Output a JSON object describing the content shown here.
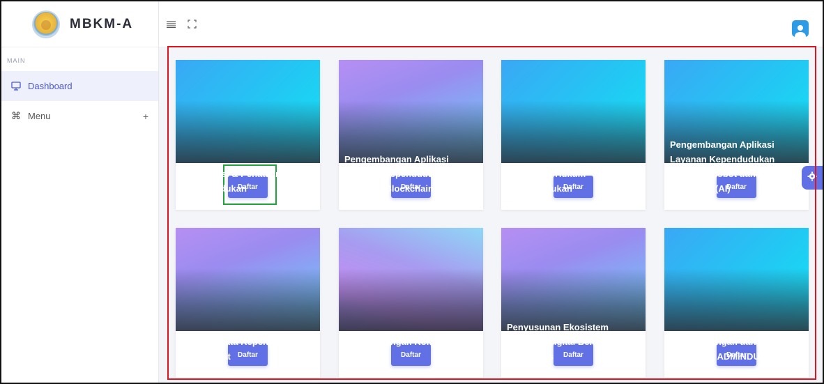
{
  "brand": {
    "name": "MBKM-A",
    "logo_icon": "university-logo-icon"
  },
  "sidebar": {
    "section_label": "MAIN",
    "items": [
      {
        "label": "Dashboard",
        "icon": "monitor-icon",
        "active": true
      },
      {
        "label": "Menu",
        "icon": "command-icon",
        "expand": "+"
      }
    ]
  },
  "header": {
    "menu_icon": "hamburger-icon",
    "fullscreen_icon": "fullscreen-icon",
    "avatar_icon": "user-avatar-icon"
  },
  "cards": [
    {
      "title": "Digitalisasi & Penataan Arsip Kependudukan",
      "button": "Daftar",
      "theme": "cyan"
    },
    {
      "title": "Pengembangan Aplikasi Layanan Kependudukan Berbasis Blockchains",
      "button": "Daftar",
      "theme": "purple"
    },
    {
      "title": "Tim Kasus Hukum Kependudukan",
      "button": "Daftar",
      "theme": "cyan"
    },
    {
      "title": "Pengembangan Aplikasi Layanan Kependudukan Berbasis Robot dan Artificial Intelegent (AI)",
      "button": "Daftar",
      "theme": "cyan"
    },
    {
      "title": "Analisis Data Kependudukan Masyarakat",
      "button": "Daftar",
      "theme": "purple"
    },
    {
      "title": "Pengembangan Komunikasi Publik",
      "button": "Daftar",
      "theme": "purple"
    },
    {
      "title": "Penyusunan Ekosistem Ekonomi Digital Berbasis Komunitas",
      "button": "Daftar",
      "theme": "purple"
    },
    {
      "title": "Pengembangan dan Inovasi Pelayanan ADMINDUK",
      "button": "Daftar",
      "theme": "cyan"
    }
  ],
  "colors": {
    "accent": "#6170e4",
    "highlight_red": "#e0131f",
    "highlight_green": "#1fa33b"
  },
  "settings_icon": "gear-icon"
}
